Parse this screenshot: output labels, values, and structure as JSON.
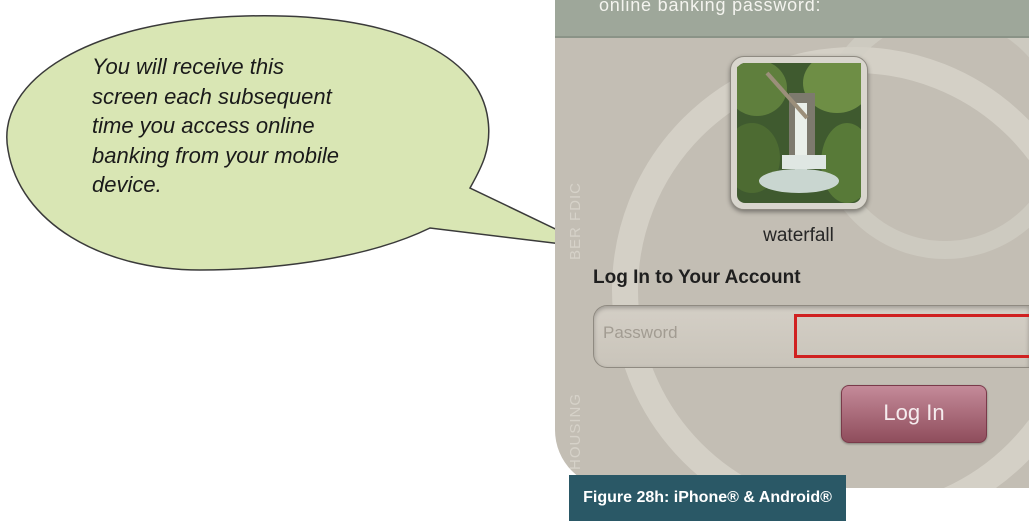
{
  "callout": {
    "lines": [
      "You will receive this",
      "screen each subsequent",
      "time you access online",
      "banking from your mobile",
      "device."
    ]
  },
  "phone": {
    "top_bar_text": "online banking password:",
    "security_image_caption": "waterfall",
    "login_heading": "Log In to Your Account",
    "password_placeholder": "Password",
    "login_button_label": "Log In",
    "side_watermark_text": "HOUSING",
    "side_watermark_text_2": "BER FDIC"
  },
  "figure_label": "Figure 28h: iPhone® & Android®",
  "colors": {
    "callout_fill": "#d9e6b4",
    "callout_stroke": "#3a3a3a",
    "phone_background": "#c3beb4",
    "top_bar": "#9ea79a",
    "highlight_red": "#d02121",
    "login_button": "#a8667a",
    "figure_label_bg": "#2a5866"
  }
}
